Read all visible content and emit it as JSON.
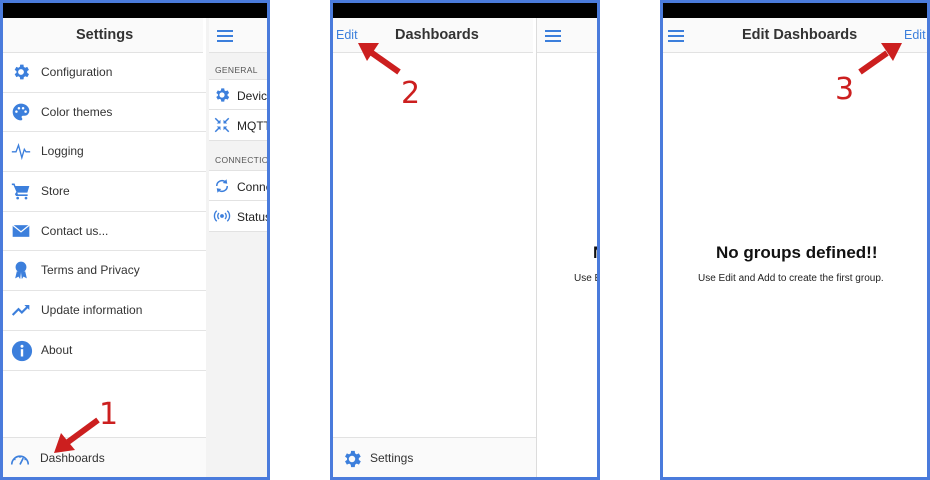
{
  "colors": {
    "accent": "#3c7fdc",
    "frame": "#4a7bdc",
    "step_red": "#cc1f1f"
  },
  "screen1": {
    "title": "Settings",
    "menu": [
      {
        "label": "Configuration",
        "icon": "gear-icon"
      },
      {
        "label": "Color themes",
        "icon": "palette-icon"
      },
      {
        "label": "Logging",
        "icon": "pulse-icon"
      },
      {
        "label": "Store",
        "icon": "cart-icon"
      },
      {
        "label": "Contact us...",
        "icon": "mail-icon"
      },
      {
        "label": "Terms and Privacy",
        "icon": "ribbon-icon"
      },
      {
        "label": "Update information",
        "icon": "trending-icon"
      },
      {
        "label": "About",
        "icon": "info-icon"
      }
    ],
    "bottom_label": "Dashboards",
    "right_pane": {
      "section_general": "GENERAL",
      "section_connection": "CONNECTIO",
      "items": [
        "Device",
        "MQTT",
        "Conne",
        "Status"
      ]
    },
    "step": "1"
  },
  "screen2": {
    "title": "Dashboards",
    "edit_label": "Edit",
    "bottom_label": "Settings",
    "partial_title": "N",
    "partial_sub": "Use E",
    "step": "2"
  },
  "screen3": {
    "title": "Edit Dashboards",
    "edit_label": "Edit",
    "empty_title": "No groups defined!!",
    "empty_sub": "Use Edit and Add to create the first group.",
    "step": "3"
  }
}
